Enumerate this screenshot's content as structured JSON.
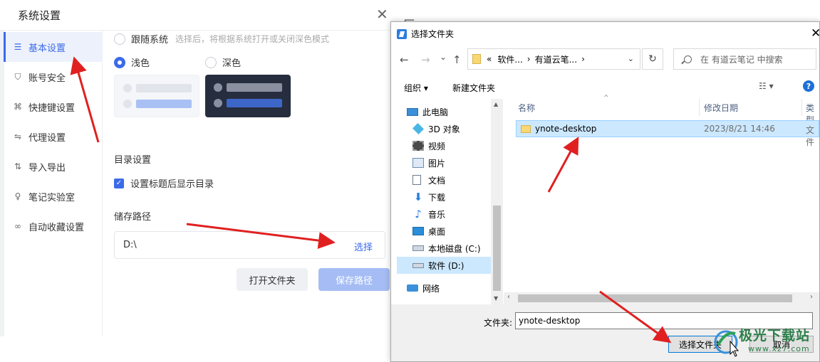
{
  "settings": {
    "title": "系统设置",
    "close": "✕",
    "sidebar": [
      {
        "label": "基本设置",
        "icon": "sliders-icon",
        "glyph": "☰"
      },
      {
        "label": "账号安全",
        "icon": "shield-icon",
        "glyph": "⛉"
      },
      {
        "label": "快捷键设置",
        "icon": "command-icon",
        "glyph": "⌘"
      },
      {
        "label": "代理设置",
        "icon": "proxy-icon",
        "glyph": "⇋"
      },
      {
        "label": "导入导出",
        "icon": "import-export-icon",
        "glyph": "⇅"
      },
      {
        "label": "笔记实验室",
        "icon": "bulb-icon",
        "glyph": "♀"
      },
      {
        "label": "自动收藏设置",
        "icon": "link-icon",
        "glyph": "∞"
      }
    ],
    "theme": {
      "follow_system": "跟随系统",
      "follow_hint": "选择后，将根据系统打开或关闭深色模式",
      "light": "浅色",
      "dark": "深色"
    },
    "toc": {
      "heading": "目录设置",
      "checkbox_label": "设置标题后显示目录",
      "check_glyph": "✓"
    },
    "storage": {
      "heading": "储存路径",
      "path": "D:\\",
      "select": "选择",
      "open_folder": "打开文件夹",
      "save_path": "保存路径"
    },
    "partial_glyph": "巨"
  },
  "picker": {
    "title": "选择文件夹",
    "close": "✕",
    "nav": {
      "back": "←",
      "forward": "→",
      "down": "⌄",
      "up": "↑"
    },
    "address": {
      "prefix": "«",
      "seg1": "软件...",
      "sep": "›",
      "seg2": "有道云笔...",
      "sep2": "›",
      "chevron": "⌄"
    },
    "refresh": "↻",
    "search_placeholder": "在 有道云笔记 中搜索",
    "organize": "组织 ▾",
    "new_folder": "新建文件夹",
    "view_glyph": "☷ ▾",
    "help": "?",
    "tree": [
      {
        "label": "此电脑",
        "icon": "computer-icon"
      },
      {
        "label": "3D 对象",
        "icon": "cube-icon"
      },
      {
        "label": "视频",
        "icon": "video-icon"
      },
      {
        "label": "图片",
        "icon": "picture-icon"
      },
      {
        "label": "文档",
        "icon": "document-icon"
      },
      {
        "label": "下载",
        "icon": "download-icon"
      },
      {
        "label": "音乐",
        "icon": "music-icon"
      },
      {
        "label": "桌面",
        "icon": "desktop-icon"
      },
      {
        "label": "本地磁盘 (C:)",
        "icon": "drive-icon"
      },
      {
        "label": "软件 (D:)",
        "icon": "drive-icon"
      },
      {
        "label": "网络",
        "icon": "network-icon"
      }
    ],
    "columns": {
      "name": "名称",
      "modified": "修改日期",
      "type": "类型"
    },
    "files": [
      {
        "name": "ynote-desktop",
        "modified": "2023/8/21 14:46",
        "type": "文件"
      }
    ],
    "folder_label": "文件夹:",
    "folder_value": "ynote-desktop",
    "select_button": "选择文件夹",
    "cancel_button": "取消",
    "scroll_up": "▲",
    "scroll_down": "▼",
    "scroll_left": "‹",
    "scroll_right": "›"
  },
  "watermark": {
    "line1": "极光下载站",
    "line2": "www.xz7.com"
  },
  "colors": {
    "accent": "#3b6be8",
    "annotation_arrow": "#e02020",
    "selection": "#cce8ff"
  }
}
